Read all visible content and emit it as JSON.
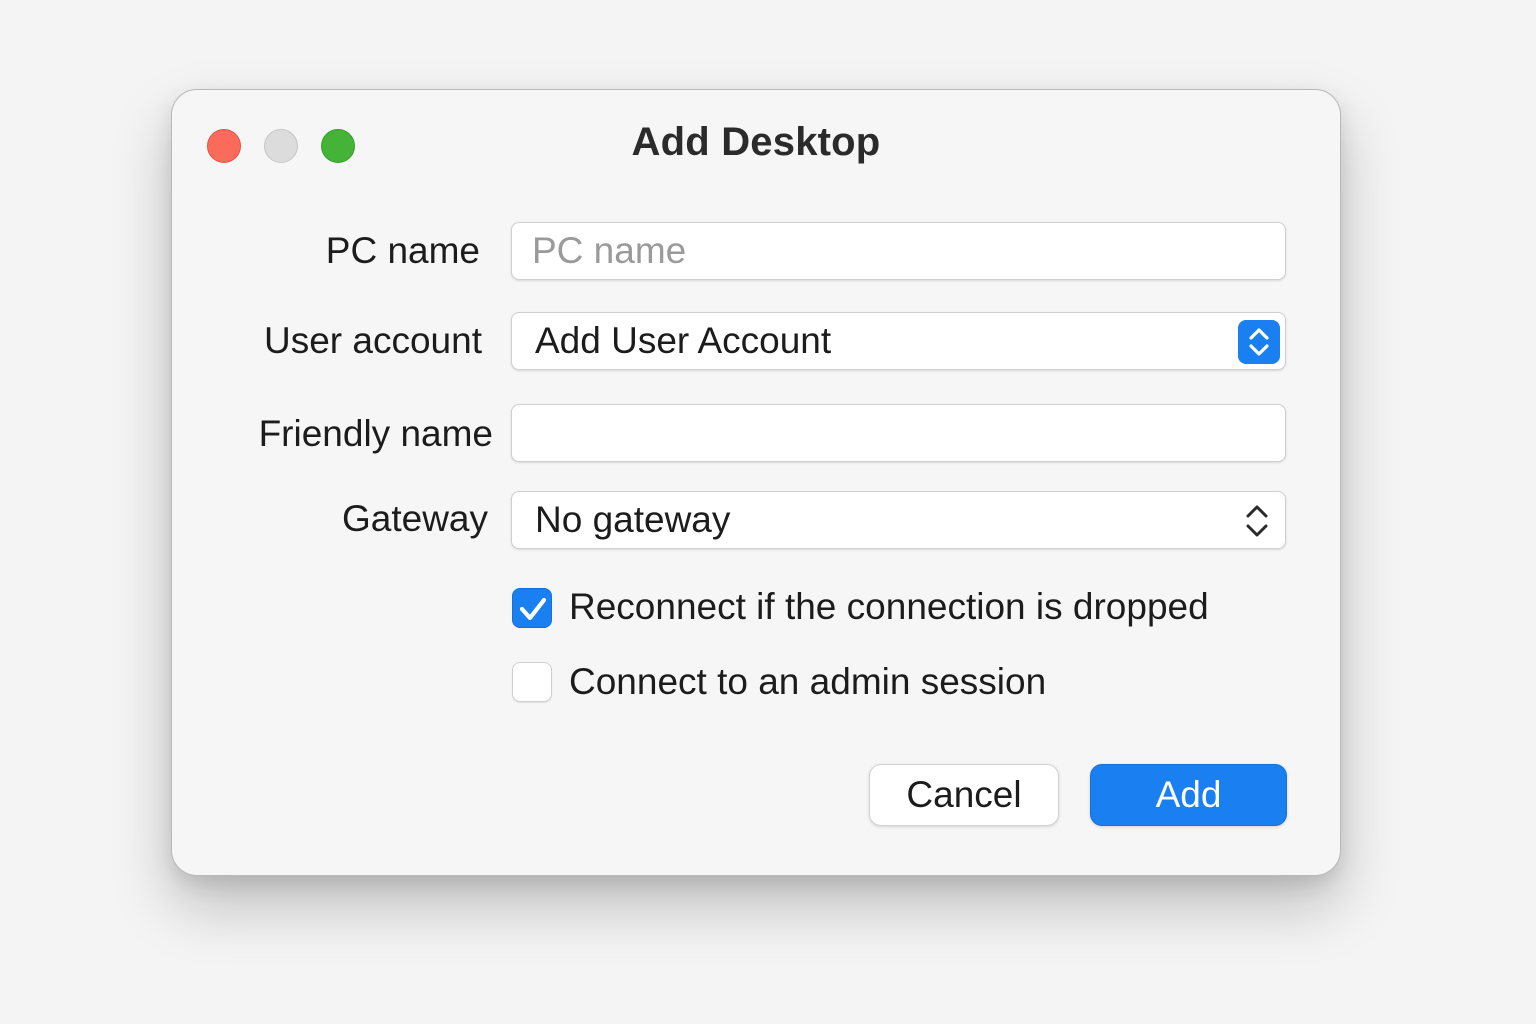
{
  "window": {
    "title": "Add Desktop"
  },
  "form": {
    "pc_name": {
      "label": "PC name",
      "placeholder": "PC name",
      "value": ""
    },
    "user_account": {
      "label": "User account",
      "value": "Add User Account",
      "control_icon": "chevron-up-down-icon"
    },
    "friendly_name": {
      "label": "Friendly name",
      "value": ""
    },
    "gateway": {
      "label": "Gateway",
      "value": "No gateway",
      "control_icon": "chevron-up-down-icon"
    },
    "reconnect": {
      "label": "Reconnect if the connection is dropped",
      "checked": true
    },
    "admin_session": {
      "label": "Connect to an admin session",
      "checked": false
    }
  },
  "buttons": {
    "cancel": "Cancel",
    "add": "Add"
  },
  "colors": {
    "accent": "#1a7ff0",
    "close": "#fb6b5c",
    "minimize": "#dcdcdc",
    "maximize": "#44b337"
  }
}
